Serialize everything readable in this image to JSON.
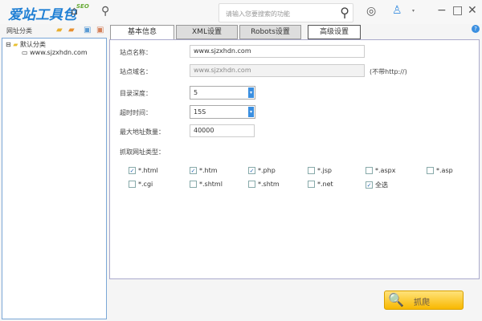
{
  "header": {
    "logo": "爱站工具包",
    "logo_sub": "SEO",
    "search_placeholder": "请输入您要搜索的功能"
  },
  "sidebar": {
    "title": "网址分类",
    "tree": {
      "root": "默认分类",
      "child": "www.sjzxhdn.com"
    }
  },
  "tabs": [
    "基本信息",
    "XML设置",
    "Robots设置",
    "高级设置"
  ],
  "form": {
    "site_name_label": "站点名称：",
    "site_name": "www.sjzxhdn.com",
    "domain_label": "站点域名：",
    "domain": "www.sjzxhdn.com",
    "domain_hint": "(不带http://)",
    "depth_label": "目录深度：",
    "depth": "5",
    "timeout_label": "超时时间：",
    "timeout": "15S",
    "max_label": "最大地址数量：",
    "max": "40000",
    "types_label": "抓取网址类型："
  },
  "types": [
    {
      "label": "*.html",
      "checked": true
    },
    {
      "label": "*.htm",
      "checked": true
    },
    {
      "label": "*.php",
      "checked": true
    },
    {
      "label": "*.jsp",
      "checked": false
    },
    {
      "label": "*.aspx",
      "checked": false
    },
    {
      "label": "*.asp",
      "checked": false
    },
    {
      "label": "*.cgi",
      "checked": false
    },
    {
      "label": "*.shtml",
      "checked": false
    },
    {
      "label": "*.shtm",
      "checked": false
    },
    {
      "label": "*.net",
      "checked": false
    },
    {
      "label": "全选",
      "checked": true
    }
  ],
  "crawl_label": "抓爬"
}
